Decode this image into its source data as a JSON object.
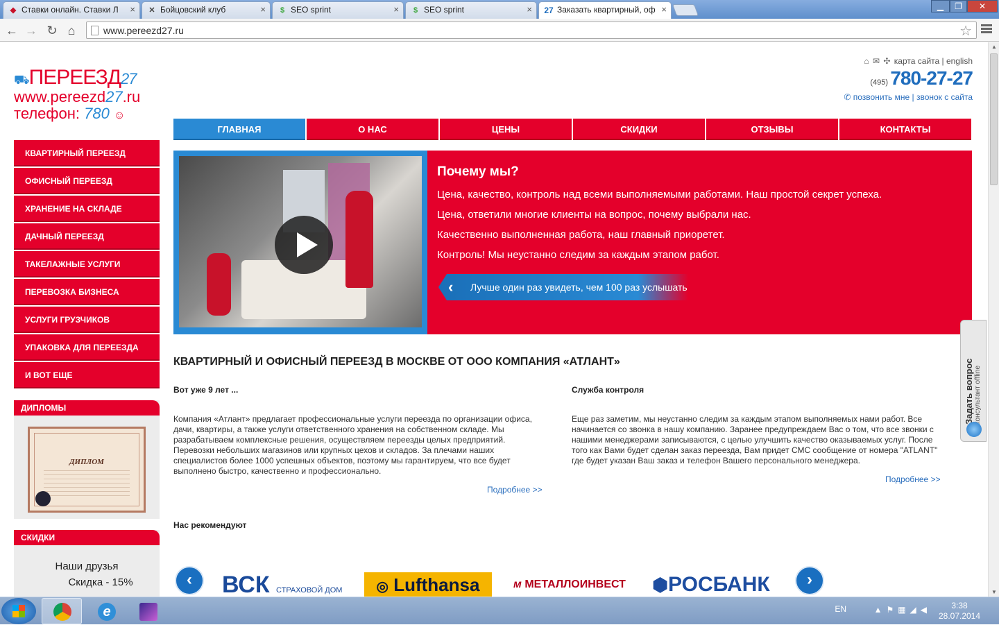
{
  "browser": {
    "tabs": [
      {
        "label": "Ставки онлайн. Ставки Л",
        "icon": "betting-icon"
      },
      {
        "label": "Бойцовский клуб",
        "icon": "fight-club-icon"
      },
      {
        "label": "SEO sprint",
        "icon": "seosprint-icon"
      },
      {
        "label": "SEO sprint",
        "icon": "seosprint-icon"
      },
      {
        "label": "Заказать квартирный, оф",
        "icon": "pereezd27-icon"
      }
    ],
    "url": "www.pereezd27.ru"
  },
  "header": {
    "logo_line1": "ПЕРЕЕЗД",
    "logo_line1_num": "27",
    "logo_line2_a": "www.pereezd",
    "logo_line2_b": "27",
    "logo_line2_c": ".ru",
    "logo_line3_a": "телефон: ",
    "logo_line3_b": "780",
    "top_links": "карта сайта | english",
    "phone_code": "(495)",
    "phone_number": "780-27-27",
    "callback": "позвонить мне | звонок с сайта"
  },
  "nav": [
    {
      "label": "ГЛАВНАЯ",
      "active": true
    },
    {
      "label": "О НАС",
      "active": false
    },
    {
      "label": "ЦЕНЫ",
      "active": false
    },
    {
      "label": "СКИДКИ",
      "active": false
    },
    {
      "label": "ОТЗЫВЫ",
      "active": false
    },
    {
      "label": "КОНТАКТЫ",
      "active": false
    }
  ],
  "sidebar": {
    "items": [
      "КВАРТИРНЫЙ ПЕРЕЕЗД",
      "ОФИСНЫЙ ПЕРЕЕЗД",
      "ХРАНЕНИЕ НА СКЛАДЕ",
      "ДАЧНЫЙ ПЕРЕЕЗД",
      "ТАКЕЛАЖНЫЕ УСЛУГИ",
      "ПЕРЕВОЗКА БИЗНЕСА",
      "УСЛУГИ ГРУЗЧИКОВ",
      "УПАКОВКА ДЛЯ ПЕРЕЕЗДА",
      "И ВОТ ЕЩЕ"
    ],
    "diplomas_title": "ДИПЛОМЫ",
    "diploma_text": "ДИПЛОМ",
    "discounts_title": "СКИДКИ",
    "friends_line1": "Наши друзья",
    "friends_line2": "Скидка - 15%"
  },
  "hero": {
    "title": "Почему мы?",
    "lines": [
      "Цена, качество, контроль над всеми выполняемыми работами. Наш простой секрет успеха.",
      "Цена, ответили многие клиенты на вопрос, почему выбрали нас.",
      "Качественно выполненная работа, наш главный приоретет.",
      "Контроль! Мы неустанно следим за каждым этапом работ."
    ],
    "button": "Лучше один раз увидеть, чем 100 раз услышать"
  },
  "content": {
    "title": "КВАРТИРНЫЙ И ОФИСНЫЙ ПЕРЕЕЗД В МОСКВЕ ОТ ООО КОМПАНИЯ «АТЛАНТ»",
    "col1_title": "Вот уже 9 лет ...",
    "col1_text": "Компания «Атлант» предлагает профессиональные услуги переезда по организации офиса, дачи, квартиры, а также услуги ответственного хранения на собственном складе. Мы разрабатываем комплексные решения, осуществляем переезды целых предприятий. Перевозки небольших магазинов или крупных цехов и складов. За плечами наших специалистов более 1000 успешных объектов, поэтому мы гарантируем, что все будет выполнено быстро, качественно и профессионально.",
    "col2_title": "Служба контроля",
    "col2_text": "Еще раз заметим, мы неустанно следим за каждым этапом выполняемых нами работ. Все начинается со звонка в нашу компанию. Заранее предупреждаем Вас о том, что все звонки с нашими менеджерами записываются, с целью улучшить качество оказываемых услуг. После того как Вами будет сделан заказ переезда, Вам придет СМС сообщение от номера \"ATLANT\" где будет указан Ваш заказ и телефон Вашего персонального менеджера.",
    "more": "Подробнее >>",
    "recommend": "Нас рекомендуют"
  },
  "partners": {
    "vsk": "ВСК",
    "vsk_sub": "СТРАХОВОЙ ДОМ",
    "lufthansa": "Lufthansa",
    "metalloinvest": "МЕТАЛЛОИНВЕСТ",
    "rosbank": "РОСБАНК"
  },
  "ask_widget": {
    "title": "Задать вопрос",
    "status": "консультант offline"
  },
  "taskbar": {
    "lang": "EN",
    "time": "3:38",
    "date": "28.07.2014"
  },
  "colors": {
    "brand_red": "#e4002b",
    "brand_blue": "#2a8ad4"
  }
}
